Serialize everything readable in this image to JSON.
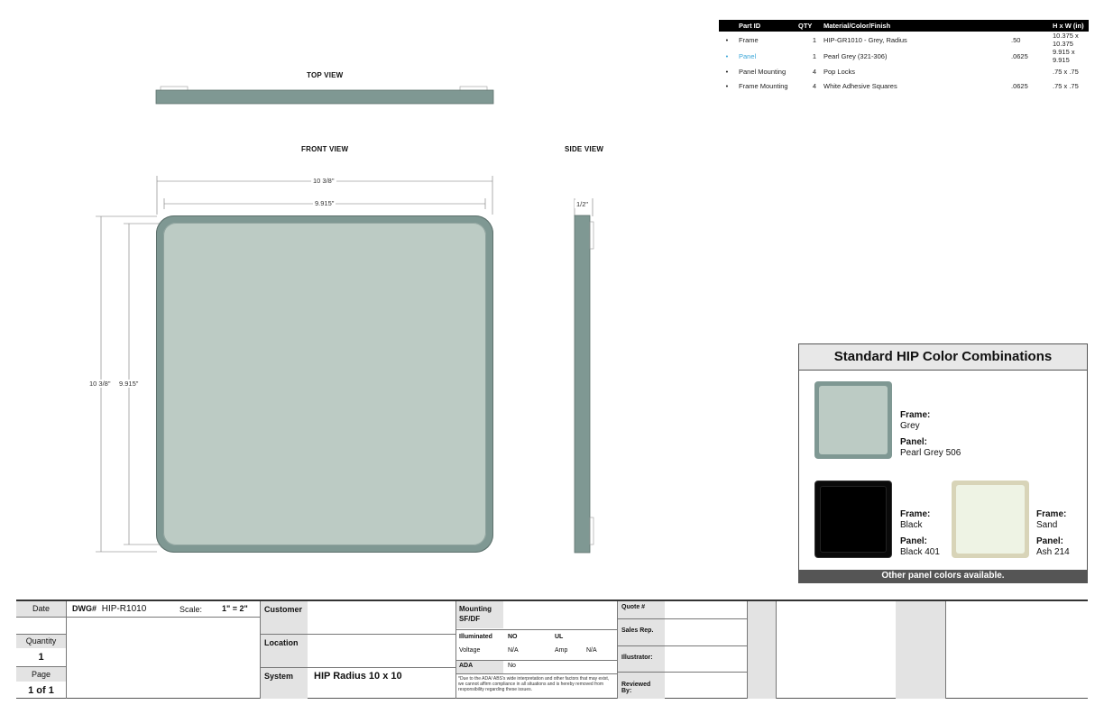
{
  "views": {
    "top": "TOP VIEW",
    "front": "FRONT VIEW",
    "side": "SIDE VIEW"
  },
  "dimensions": {
    "outer_width": "10 3/8\"",
    "inner_width": "9.915\"",
    "outer_height": "10 3/8\"",
    "inner_height": "9.915\"",
    "depth": "1/2\""
  },
  "parts_table": {
    "headers": [
      "Part ID",
      "QTY",
      "Material/Color/Finish",
      "",
      "H x W (in)"
    ],
    "rows": [
      {
        "part": "Frame",
        "qty": "1",
        "material": "HIP-GR1010 - Grey, Radius",
        "thickness": ".50",
        "size": "10.375 x 10.375",
        "highlight": false
      },
      {
        "part": "Panel",
        "qty": "1",
        "material": "Pearl Grey (321-306)",
        "thickness": ".0625",
        "size": "9.915 x 9.915",
        "highlight": true
      },
      {
        "part": "Panel Mounting",
        "qty": "4",
        "material": "Pop Locks",
        "thickness": "",
        "size": ".75 x .75",
        "highlight": false
      },
      {
        "part": "Frame Mounting",
        "qty": "4",
        "material": "White Adhesive Squares",
        "thickness": ".0625",
        "size": ".75 x .75",
        "highlight": false
      }
    ]
  },
  "color_combinations": {
    "title": "Standard HIP Color Combinations",
    "footer": "Other panel colors available.",
    "items": [
      {
        "frame_label": "Frame:",
        "frame": "Grey",
        "panel_label": "Panel:",
        "panel": "Pearl Grey 506",
        "frame_color": "#7f9893",
        "panel_color": "#bccbc4"
      },
      {
        "frame_label": "Frame:",
        "frame": "Black",
        "panel_label": "Panel:",
        "panel": "Black 401",
        "frame_color": "#0a0a0a",
        "panel_color": "#000000"
      },
      {
        "frame_label": "Frame:",
        "frame": "Sand",
        "panel_label": "Panel:",
        "panel": "Ash 214",
        "frame_color": "#d8d4b8",
        "panel_color": "#eef3e4"
      }
    ]
  },
  "title_block": {
    "date_label": "Date",
    "dwg_label": "DWG#",
    "dwg_value": "HIP-R1010",
    "scale_label": "Scale:",
    "scale_value": "1\" = 2\"",
    "quantity_label": "Quantity",
    "quantity_value": "1",
    "page_label": "Page",
    "page_value": "1 of 1",
    "customer_label": "Customer",
    "location_label": "Location",
    "system_label": "System",
    "system_value": "HIP Radius 10 x 10",
    "mounting_label": "Mounting",
    "mounting_sub": "SF/DF",
    "illuminated_label": "Illuminated",
    "illuminated_value": "NO",
    "ul_label": "UL",
    "voltage_label": "Voltage",
    "voltage_value": "N/A",
    "amp_label": "Amp",
    "amp_value": "N/A",
    "ada_label": "ADA",
    "ada_value": "No",
    "disclaimer": "*Due to the ADA/ ABS's wide interpretation and other factors that may exist, we cannot affirm compliance in all situations and is hereby removed from responsibility regarding these issues.",
    "quote_label": "Quote #",
    "sales_label": "Sales Rep.",
    "illustrator_label": "Illustrator:",
    "reviewed_label": "Reviewed By:"
  },
  "colors": {
    "frame": "#7f9893",
    "panel": "#bccbc4",
    "highlight_blue": "#3aa6d8"
  }
}
